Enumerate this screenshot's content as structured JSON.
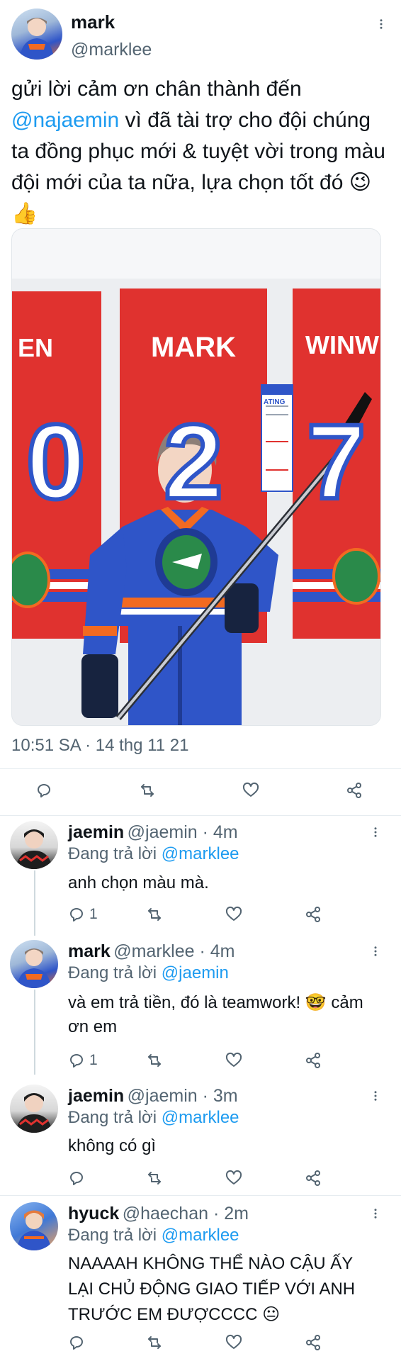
{
  "main_tweet": {
    "name": "mark",
    "handle": "@marklee",
    "text_before": "gửi lời cảm ơn chân thành đến",
    "mention": "@najaemin",
    "text_after": "vì đã tài trợ cho đội chúng ta đồng phục mới & tuyệt vời trong màu đội mới của ta nữa, lựa chọn tốt đó",
    "emoji": "😉👍",
    "photo": {
      "banner_left": "EN",
      "banner_center": "MARK",
      "banner_right": "WINW",
      "number_left": "0",
      "number_center": "2",
      "number_right": "7",
      "sign_text": "ATING"
    },
    "timestamp": "10:51 SA · 14 thg 11 21"
  },
  "replies": [
    {
      "name": "jaemin",
      "handle": "@jaemin · 4m",
      "reply_prefix": "Đang trả lời",
      "reply_to": "@marklee",
      "text": "anh chọn màu mà.",
      "reply_count": "1"
    },
    {
      "name": "mark",
      "handle": "@marklee · 4m",
      "reply_prefix": "Đang trả lời",
      "reply_to": "@jaemin",
      "text": "và em trả tiền, đó là teamwork! 🤓 cảm ơn em",
      "reply_count": "1"
    },
    {
      "name": "jaemin",
      "handle": "@jaemin · 3m",
      "reply_prefix": "Đang trả lời",
      "reply_to": "@marklee",
      "text": "không có gì",
      "reply_count": ""
    },
    {
      "name": "hyuck",
      "handle": "@haechan · 2m",
      "reply_prefix": "Đang trả lời",
      "reply_to": "@marklee",
      "text": "NAAAAH KHÔNG THỂ NÀO CẬU ẤY LẠI CHỦ ĐỘNG GIAO TIẾP VỚI ANH TRƯỚC EM ĐƯỢCCCC 😐",
      "reply_count": ""
    }
  ],
  "colors": {
    "accent": "#1d9bf0",
    "banner_red": "#e0322f",
    "jersey_blue": "#2f55c8",
    "jersey_orange": "#f26a21"
  },
  "icons": [
    "more-icon",
    "reply-icon",
    "retweet-icon",
    "like-icon",
    "share-icon"
  ]
}
